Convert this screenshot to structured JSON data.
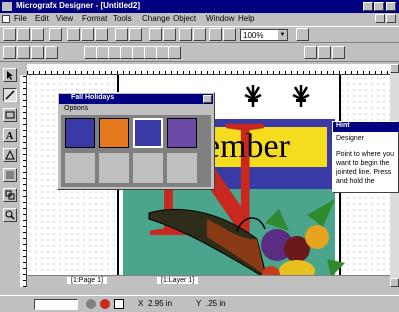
{
  "window": {
    "title": "Micrografx Designer - [Untitled2]"
  },
  "menu": [
    "File",
    "Edit",
    "View",
    "Format",
    "Tools",
    "Change",
    "Object",
    "Window",
    "Help"
  ],
  "toolbar": {
    "zoom": "100%"
  },
  "palette": {
    "title": "Fall Holidays",
    "menu_label": "Options"
  },
  "document": {
    "banner_text": "ember",
    "big_letter": "N"
  },
  "hint": {
    "title": "Hint",
    "heading": "Designer",
    "body": "Point to where you want to begin the jointed line. Press and hold the"
  },
  "tabs": {
    "page": "[1:Page 1]",
    "layer": "[1:Layer 1]"
  },
  "status": {
    "x": "2.95 in",
    "y": ".25 in"
  },
  "colors": {
    "title_blue": "#000080",
    "doc_blue": "#3a3aa6",
    "banner_yellow": "#f5dc1e",
    "teal": "#4aa58c",
    "red": "#c8281e"
  }
}
